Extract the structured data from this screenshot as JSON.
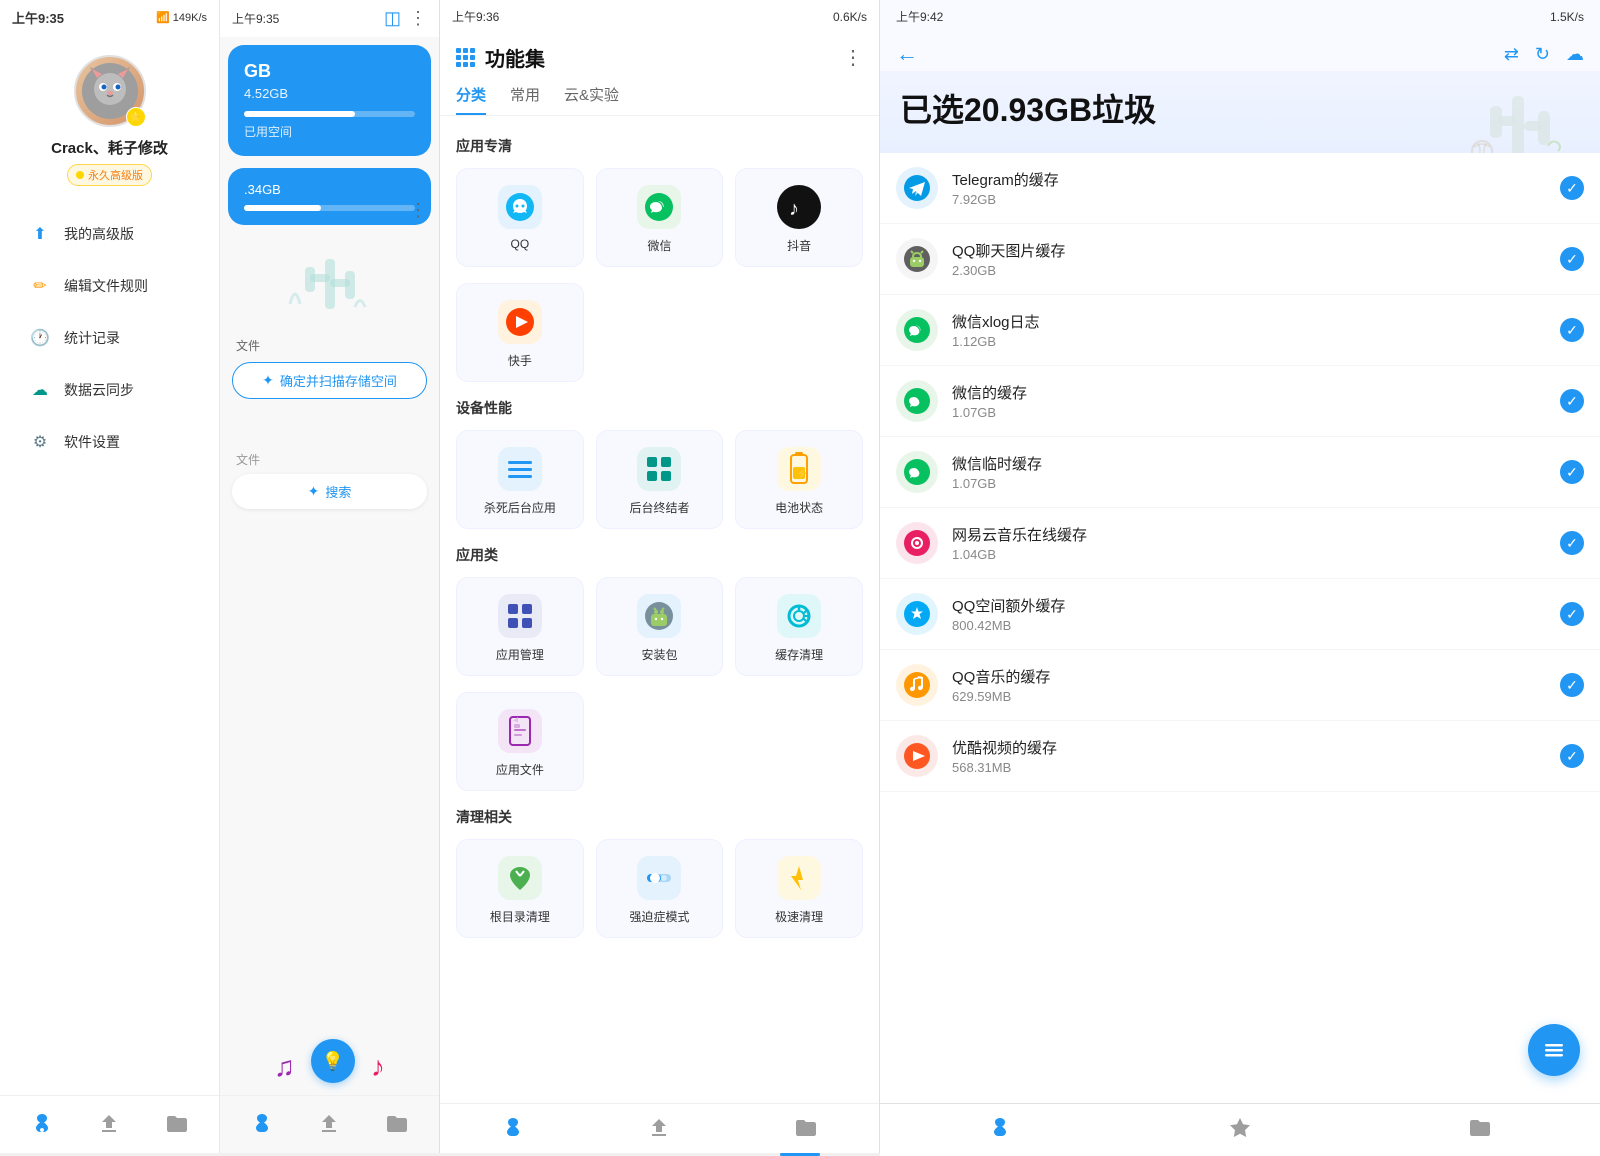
{
  "panel1": {
    "status_time": "上午9:35",
    "status_icons": "149K/s",
    "profile_name": "Crack、耗子修改",
    "profile_badge": "永久高级版",
    "nav_items": [
      {
        "label": "我的高级版",
        "icon": "⬆️",
        "color": "blue"
      },
      {
        "label": "编辑文件规则",
        "icon": "✏️",
        "color": "orange"
      },
      {
        "label": "统计记录",
        "icon": "🕐",
        "color": "green"
      },
      {
        "label": "数据云同步",
        "icon": "☁️",
        "color": "teal"
      },
      {
        "label": "软件设置",
        "icon": "⚙️",
        "color": "gray"
      }
    ],
    "bottom_nav": [
      {
        "icon": "✳",
        "label": "fan",
        "active": true
      },
      {
        "icon": "⬆",
        "label": "upload"
      },
      {
        "icon": "📁",
        "label": "folder"
      }
    ]
  },
  "panel2": {
    "status_time": "上午9:35",
    "storage_title": "GB",
    "storage_used": "4.52GB",
    "storage_label": "已用空间",
    "storage2_used": ".34GB",
    "scan_label": "文件",
    "scan_btn": "确定并扫描存储空间",
    "file_label": "文件",
    "search_btn": "搜索",
    "more_btn": "⋮"
  },
  "panel3": {
    "status_time": "上午9:36",
    "status_icons": "0.6K/s",
    "title": "功能集",
    "tabs": [
      {
        "label": "分类",
        "active": true
      },
      {
        "label": "常用",
        "active": false
      },
      {
        "label": "云&实验",
        "active": false
      }
    ],
    "sections": [
      {
        "title": "应用专清",
        "items": [
          {
            "label": "QQ",
            "icon": "🐧",
            "bg": "blue-light"
          },
          {
            "label": "微信",
            "icon": "💬",
            "bg": "green-light"
          },
          {
            "label": "抖音",
            "icon": "♪",
            "bg": "dark"
          }
        ]
      },
      {
        "title": "",
        "items": [
          {
            "label": "快手",
            "icon": "🌀",
            "bg": "orange-light"
          }
        ]
      },
      {
        "title": "设备性能",
        "items": [
          {
            "label": "杀死后台应用",
            "icon": "≡",
            "bg": "blue-light"
          },
          {
            "label": "后台终结者",
            "icon": "⊞",
            "bg": "teal-light"
          },
          {
            "label": "电池状态",
            "icon": "🔋",
            "bg": "amber-light"
          }
        ]
      },
      {
        "title": "应用类",
        "items": [
          {
            "label": "应用管理",
            "icon": "⊞",
            "bg": "indigo-light"
          },
          {
            "label": "安装包",
            "icon": "🤖",
            "bg": "blue-light"
          },
          {
            "label": "缓存清理",
            "icon": "⚙",
            "bg": "cyan-light"
          }
        ]
      },
      {
        "title": "",
        "items": [
          {
            "label": "应用文件",
            "icon": "🔖",
            "bg": "purple-light"
          }
        ]
      },
      {
        "title": "清理相关",
        "items": [
          {
            "label": "根目录清理",
            "icon": "🌿",
            "bg": "green-light"
          },
          {
            "label": "强迫症模式",
            "icon": "⊕",
            "bg": "blue-light"
          },
          {
            "label": "极速清理",
            "icon": "⚡",
            "bg": "amber-light"
          }
        ]
      }
    ],
    "bottom_nav": [
      {
        "icon": "✳",
        "active": true
      },
      {
        "icon": "⬆",
        "active": false
      },
      {
        "icon": "📁",
        "active": false
      }
    ]
  },
  "panel4": {
    "status_time": "上午9:42",
    "status_icons": "1.5K/s",
    "junk_title": "已选20.93GB垃圾",
    "items": [
      {
        "name": "Telegram的缓存",
        "size": "7.92GB",
        "bg": "#E3F2FD",
        "color": "#039BE5",
        "icon": "✈"
      },
      {
        "name": "QQ聊天图片缓存",
        "size": "2.30GB",
        "bg": "#F5F5F5",
        "color": "#424242",
        "icon": "🤖"
      },
      {
        "name": "微信xlog日志",
        "size": "1.12GB",
        "bg": "#E8F5E9",
        "color": "#43A047",
        "icon": "💬"
      },
      {
        "name": "微信的缓存",
        "size": "1.07GB",
        "bg": "#E8F5E9",
        "color": "#43A047",
        "icon": "💬"
      },
      {
        "name": "微信临时缓存",
        "size": "1.07GB",
        "bg": "#E8F5E9",
        "color": "#43A047",
        "icon": "💬"
      },
      {
        "name": "网易云音乐在线缓存",
        "size": "1.04GB",
        "bg": "#FCE4EC",
        "color": "#E91E63",
        "icon": "🎵"
      },
      {
        "name": "QQ空间额外缓存",
        "size": "800.42MB",
        "bg": "#E1F5FE",
        "color": "#03A9F4",
        "icon": "◑"
      },
      {
        "name": "QQ音乐的缓存",
        "size": "629.59MB",
        "bg": "#FFF3E0",
        "color": "#FF9800",
        "icon": "♫"
      },
      {
        "name": "优酷视频的缓存",
        "size": "568.31MB",
        "bg": "#FBE9E7",
        "color": "#FF5722",
        "icon": "▶"
      }
    ],
    "fab_icon": "≡",
    "back_icon": "←",
    "header_icons": [
      "⇄",
      "↻",
      "☁"
    ]
  }
}
